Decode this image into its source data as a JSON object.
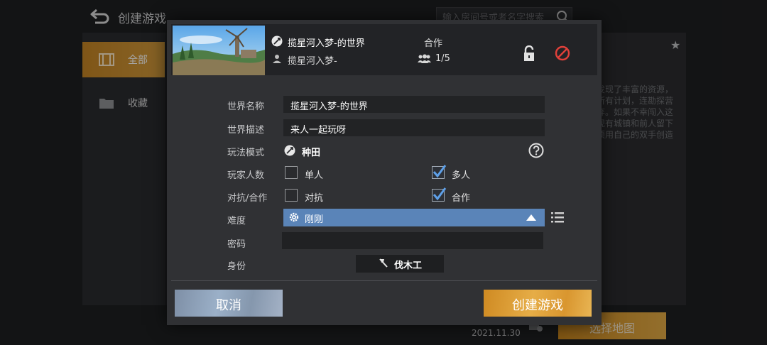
{
  "background": {
    "title": "创建游戏",
    "search_placeholder": "输入房间号或者名字搜索",
    "sidebar": [
      {
        "label": "全部",
        "active": true
      },
      {
        "label": "收藏",
        "active": false
      }
    ],
    "description": "行家们在这里发现了丰富的资源，但异变破坏了所有计划，连勘探营地也随即被废弃。如果不幸闯入这里，你就会发现有城镇和前人留下的痕迹，你必须用自己的双手创造出一切。",
    "date": "2021.11.30",
    "select_map_label": "选择地图"
  },
  "dialog": {
    "header": {
      "world_name": "揽星河入梦-的世界",
      "owner": "揽星河入梦-",
      "mode": "合作",
      "players": "1/5"
    },
    "fields": {
      "world_name_label": "世界名称",
      "world_name_value": "揽星河入梦-的世界",
      "world_desc_label": "世界描述",
      "world_desc_value": "来人一起玩呀",
      "gameplay_label": "玩法模式",
      "gameplay_value": "种田",
      "player_count_label": "玩家人数",
      "single_label": "单人",
      "multi_label": "多人",
      "pvp_label": "对抗/合作",
      "versus_label": "对抗",
      "coop_label": "合作",
      "difficulty_label": "难度",
      "difficulty_value": "刚刚",
      "password_label": "密码",
      "password_value": "",
      "identity_label": "身份",
      "identity_value": "伐木工"
    },
    "checkboxes": {
      "single": false,
      "multi": true,
      "versus": false,
      "coop": true
    },
    "buttons": {
      "cancel": "取消",
      "create": "创建游戏"
    }
  },
  "colors": {
    "accent_gold": "#d9962f",
    "accent_blue": "#5a84b8",
    "ban_red": "#e0403a"
  }
}
